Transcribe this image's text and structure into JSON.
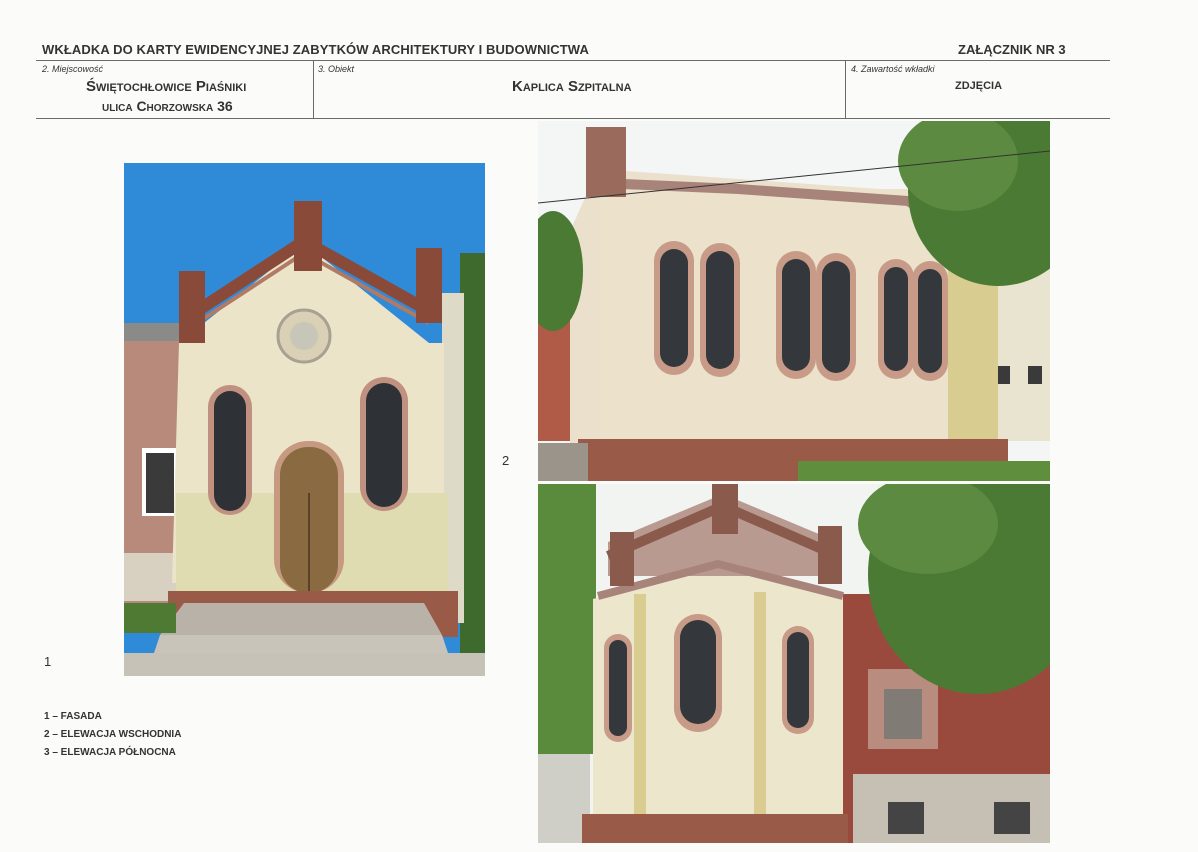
{
  "header": {
    "title": "WKŁADKA DO KARTY EWIDENCYJNEJ ZABYTKÓW ARCHITEKTURY I BUDOWNICTWA",
    "annex": "ZAŁĄCZNIK NR 3"
  },
  "fields": {
    "location": {
      "label": "2. Miejscowość",
      "line1": "Świętochłowice Piaśniki",
      "line2": "ulica Chorzowska 36"
    },
    "object": {
      "label": "3. Obiekt",
      "value": "Kaplica Szpitalna"
    },
    "content": {
      "label": "4. Zawartość wkładki",
      "value": "ZDJĘCIA"
    }
  },
  "photos": [
    {
      "number": "1"
    },
    {
      "number": "2"
    }
  ],
  "legend": [
    "1 – FASADA",
    "2 – ELEWACJA WSCHODNIA",
    "3 – ELEWACJA PÓŁNOCNA"
  ],
  "colors": {
    "sky": "#2f8ad8",
    "wall": "#ece4c8",
    "brick": "#9a5a48",
    "tree": "#4a7a34"
  }
}
